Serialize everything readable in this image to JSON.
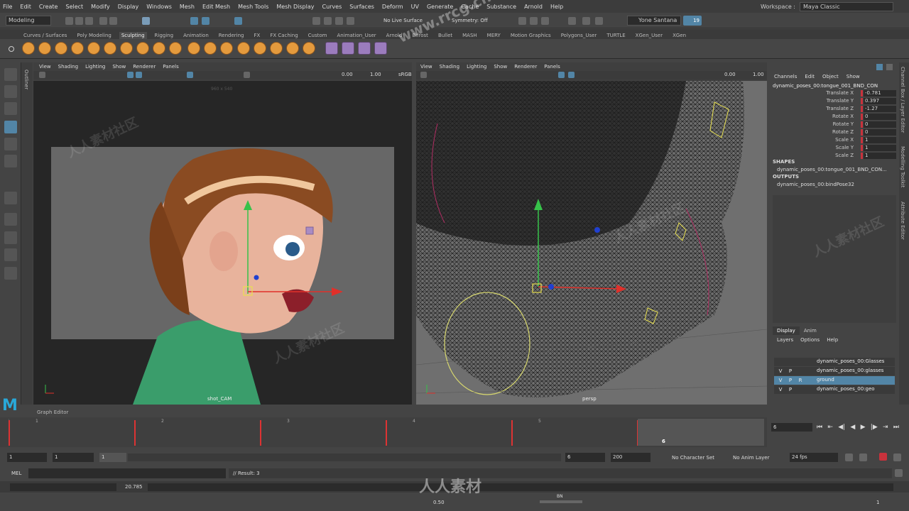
{
  "menubar": {
    "items": [
      "File",
      "Edit",
      "Create",
      "Select",
      "Modify",
      "Display",
      "Windows",
      "Mesh",
      "Edit Mesh",
      "Mesh Tools",
      "Mesh Display",
      "Curves",
      "Surfaces",
      "Deform",
      "UV",
      "Generate",
      "Cache",
      "Substance",
      "Arnold",
      "Help"
    ],
    "workspace_label": "Workspace :",
    "workspace_value": "Maya Classic"
  },
  "statusline": {
    "mode": "Modeling",
    "live_surface": "No Live Surface",
    "symmetry": "Symmetry: Off",
    "user": "Yone Santana",
    "notifications": "19"
  },
  "shelf_tabs": [
    "Curves / Surfaces",
    "Poly Modeling",
    "Sculpting",
    "Rigging",
    "Animation",
    "Rendering",
    "FX",
    "FX Caching",
    "Custom",
    "Animation_User",
    "Arnold",
    "Bifrost",
    "Bullet",
    "MASH",
    "MERY",
    "Motion Graphics",
    "Polygons_User",
    "TURTLE",
    "XGen_User",
    "XGen"
  ],
  "active_shelf": "Sculpting",
  "viewport_left": {
    "menu": [
      "View",
      "Shading",
      "Lighting",
      "Show",
      "Renderer",
      "Panels"
    ],
    "field1": "0.00",
    "field2": "1.00",
    "colorspace": "sRGB",
    "resolution": "960 x 540",
    "camera": "shot_CAM"
  },
  "viewport_right": {
    "menu": [
      "View",
      "Shading",
      "Lighting",
      "Show",
      "Renderer",
      "Panels"
    ],
    "field1": "0.00",
    "field2": "1.00",
    "camera": "persp"
  },
  "channelbox": {
    "menu": [
      "Channels",
      "Edit",
      "Object",
      "Show"
    ],
    "object": "dynamic_poses_00:tongue_001_BND_CON",
    "attributes": [
      {
        "name": "Translate X",
        "value": "-0.781"
      },
      {
        "name": "Translate Y",
        "value": "0.397"
      },
      {
        "name": "Translate Z",
        "value": "-1.27"
      },
      {
        "name": "Rotate X",
        "value": "0"
      },
      {
        "name": "Rotate Y",
        "value": "0"
      },
      {
        "name": "Rotate Z",
        "value": "0"
      },
      {
        "name": "Scale X",
        "value": "1"
      },
      {
        "name": "Scale Y",
        "value": "1"
      },
      {
        "name": "Scale Z",
        "value": "1"
      }
    ],
    "shapes_label": "SHAPES",
    "shape_item": "dynamic_poses_00:tongue_001_BND_CON...",
    "outputs_label": "OUTPUTS",
    "output_item": "dynamic_poses_00:bindPose32"
  },
  "layers": {
    "tabs": [
      "Display",
      "Anim"
    ],
    "menu": [
      "Layers",
      "Options",
      "Help"
    ],
    "rows": [
      {
        "v": "",
        "p": "",
        "r": "",
        "name": "dynamic_poses_00:Glasses",
        "selected": false
      },
      {
        "v": "V",
        "p": "P",
        "r": "",
        "name": "dynamic_poses_00:glasses",
        "selected": false
      },
      {
        "v": "V",
        "p": "P",
        "r": "R",
        "name": "ground",
        "selected": true
      },
      {
        "v": "V",
        "p": "P",
        "r": "",
        "name": "dynamic_poses_00:geo",
        "selected": false
      }
    ]
  },
  "side_tabs": [
    "Channel Box / Layer Editor",
    "Modelling Toolkit",
    "Attribute Editor"
  ],
  "outliner_tab": "Outliner",
  "graph_editor_tab": "Graph Editor",
  "timeslider": {
    "ticks": [
      "1",
      "2",
      "3",
      "4",
      "5",
      "6"
    ],
    "current_frame_label": "6",
    "current_frame": "6"
  },
  "range": {
    "start": "1",
    "start2": "1",
    "layer_field": "1",
    "end": "6",
    "end2": "200",
    "character_set": "No Character Set",
    "anim_layer": "No Anim Layer",
    "fps": "24 fps"
  },
  "cmdline": {
    "lang": "MEL",
    "result": "// Result: 3"
  },
  "helpline": {
    "value": "20.785"
  },
  "bottom": {
    "value": "0.50",
    "right_num": "1",
    "bn_label": "BN"
  },
  "watermark": "www.rrcg.cn",
  "watermark2": "人人素材",
  "watermark_tile": "人人素材社区",
  "accent": "#5285a6",
  "key_color": "#d33333"
}
